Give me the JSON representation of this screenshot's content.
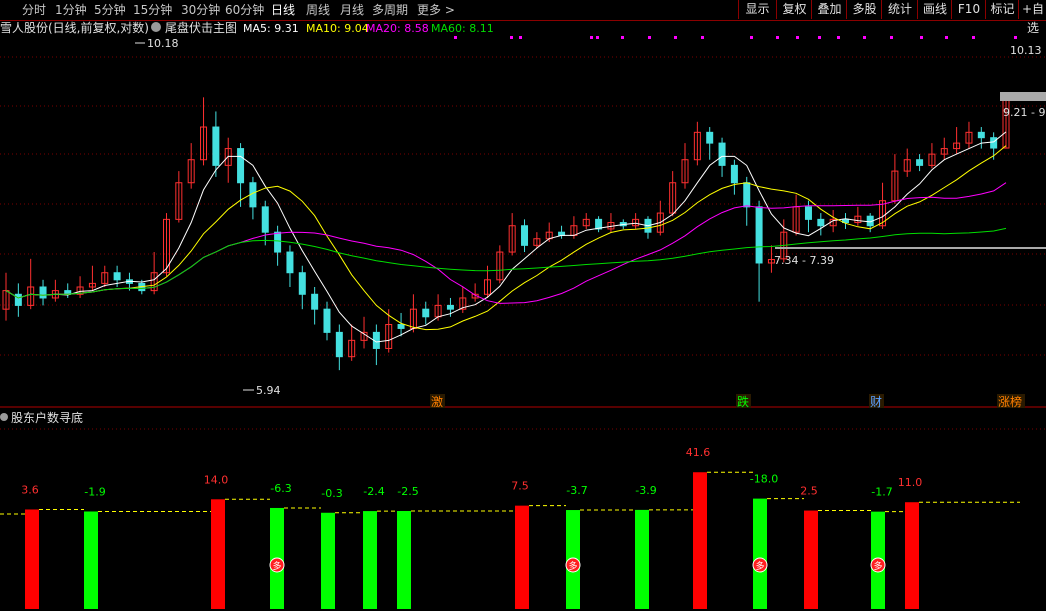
{
  "toolbar": {
    "periods": [
      "分时",
      "1分钟",
      "5分钟",
      "15分钟",
      "30分钟",
      "60分钟",
      "日线",
      "周线",
      "月线",
      "多周期",
      "更多 >"
    ],
    "active_index": 6,
    "right_buttons": [
      "显示",
      "复权",
      "叠加",
      "多股",
      "统计",
      "画线",
      "F10",
      "标记",
      "+自选"
    ]
  },
  "main_panel": {
    "title": "雪人股份(日线,前复权,对数)",
    "indicator_name": "尾盘伏击主图",
    "ma": [
      {
        "label": "MA5: 9.31",
        "color": "#ffffff"
      },
      {
        "label": "MA10: 9.04",
        "color": "#ffff00"
      },
      {
        "label": "MA20: 8.58",
        "color": "#ff00ff"
      },
      {
        "label": "MA60: 8.11",
        "color": "#00dd00"
      }
    ],
    "annotations": {
      "high": "10.18",
      "low": "5.94",
      "range": "7.34 - 7.39",
      "last_high": "10.13",
      "last_price": "9.21 - 9"
    },
    "events": [
      {
        "text": "激",
        "color": "#ff7f00"
      },
      {
        "text": "跌",
        "color": "#00ff00"
      },
      {
        "text": "财",
        "color": "#5aa0ff"
      },
      {
        "text": "涨榜",
        "color": "#ff7f00"
      }
    ]
  },
  "sub_panel": {
    "title": "股东户数寻底",
    "badge": "多"
  },
  "colors": {
    "up": "#ff3030",
    "down": "#44e0e0",
    "ma5": "#ffffff",
    "ma10": "#ffff00",
    "ma20": "#ff00ff",
    "ma60": "#00dd00",
    "bar_up": "#ff0000",
    "bar_down": "#00ff00"
  },
  "chart_data": {
    "type": "candlestick",
    "price_range": [
      5.6,
      11.4
    ],
    "scale": "log",
    "candles": [
      [
        6.7,
        6.95,
        7.2,
        6.55
      ],
      [
        6.9,
        6.75,
        7.05,
        6.6
      ],
      [
        6.75,
        7.0,
        7.4,
        6.7
      ],
      [
        7.0,
        6.85,
        7.1,
        6.75
      ],
      [
        6.85,
        6.95,
        7.1,
        6.8
      ],
      [
        6.95,
        6.9,
        7.05,
        6.85
      ],
      [
        6.9,
        7.0,
        7.15,
        6.85
      ],
      [
        7.0,
        7.05,
        7.3,
        6.95
      ],
      [
        7.05,
        7.2,
        7.3,
        7.0
      ],
      [
        7.2,
        7.1,
        7.3,
        7.0
      ],
      [
        7.1,
        7.05,
        7.2,
        6.95
      ],
      [
        7.05,
        6.95,
        7.1,
        6.9
      ],
      [
        6.95,
        7.2,
        7.5,
        6.9
      ],
      [
        7.2,
        8.0,
        8.1,
        7.15
      ],
      [
        8.0,
        8.6,
        8.8,
        7.95
      ],
      [
        8.6,
        9.0,
        9.3,
        8.5
      ],
      [
        9.0,
        9.6,
        10.18,
        8.9
      ],
      [
        9.6,
        8.9,
        9.9,
        8.7
      ],
      [
        8.9,
        9.2,
        9.4,
        8.6
      ],
      [
        9.2,
        8.6,
        9.3,
        8.2
      ],
      [
        8.6,
        8.2,
        8.7,
        8.0
      ],
      [
        8.2,
        7.8,
        8.3,
        7.6
      ],
      [
        7.8,
        7.5,
        7.9,
        7.3
      ],
      [
        7.5,
        7.2,
        7.6,
        7.0
      ],
      [
        7.2,
        6.9,
        7.3,
        6.7
      ],
      [
        6.9,
        6.7,
        7.0,
        6.5
      ],
      [
        6.7,
        6.4,
        6.8,
        6.3
      ],
      [
        6.4,
        6.1,
        6.5,
        5.94
      ],
      [
        6.1,
        6.3,
        6.5,
        6.05
      ],
      [
        6.3,
        6.4,
        6.6,
        6.2
      ],
      [
        6.4,
        6.2,
        6.5,
        6.0
      ],
      [
        6.2,
        6.5,
        6.7,
        6.15
      ],
      [
        6.5,
        6.45,
        6.65,
        6.35
      ],
      [
        6.45,
        6.7,
        6.9,
        6.4
      ],
      [
        6.7,
        6.6,
        6.8,
        6.5
      ],
      [
        6.6,
        6.75,
        6.9,
        6.55
      ],
      [
        6.75,
        6.7,
        6.85,
        6.6
      ],
      [
        6.7,
        6.85,
        7.0,
        6.65
      ],
      [
        6.85,
        6.9,
        7.05,
        6.8
      ],
      [
        6.9,
        7.1,
        7.3,
        6.85
      ],
      [
        7.1,
        7.5,
        7.6,
        7.05
      ],
      [
        7.5,
        7.9,
        8.1,
        7.45
      ],
      [
        7.9,
        7.6,
        8.0,
        7.5
      ],
      [
        7.6,
        7.7,
        7.8,
        7.55
      ],
      [
        7.7,
        7.8,
        7.95,
        7.65
      ],
      [
        7.8,
        7.75,
        7.9,
        7.7
      ],
      [
        7.75,
        7.9,
        8.05,
        7.7
      ],
      [
        7.9,
        8.0,
        8.1,
        7.85
      ],
      [
        8.0,
        7.85,
        8.05,
        7.8
      ],
      [
        7.85,
        7.95,
        8.1,
        7.8
      ],
      [
        7.95,
        7.9,
        8.0,
        7.85
      ],
      [
        7.9,
        8.0,
        8.1,
        7.85
      ],
      [
        8.0,
        7.8,
        8.05,
        7.7
      ],
      [
        7.8,
        8.1,
        8.3,
        7.75
      ],
      [
        8.1,
        8.6,
        8.8,
        8.05
      ],
      [
        8.6,
        9.0,
        9.3,
        8.5
      ],
      [
        9.0,
        9.5,
        9.7,
        8.9
      ],
      [
        9.5,
        9.3,
        9.6,
        9.0
      ],
      [
        9.3,
        8.9,
        9.4,
        8.7
      ],
      [
        8.9,
        8.6,
        9.0,
        8.4
      ],
      [
        8.6,
        8.2,
        8.7,
        7.9
      ],
      [
        8.2,
        7.34,
        8.3,
        6.8
      ],
      [
        7.34,
        7.39,
        7.6,
        7.2
      ],
      [
        7.4,
        7.8,
        8.0,
        7.35
      ],
      [
        7.8,
        8.2,
        8.4,
        7.75
      ],
      [
        8.2,
        8.0,
        8.3,
        7.8
      ],
      [
        8.0,
        7.9,
        8.1,
        7.75
      ],
      [
        7.9,
        8.0,
        8.15,
        7.8
      ],
      [
        8.0,
        7.95,
        8.1,
        7.85
      ],
      [
        7.95,
        8.05,
        8.2,
        7.9
      ],
      [
        8.05,
        7.9,
        8.1,
        7.8
      ],
      [
        7.9,
        8.3,
        8.6,
        7.85
      ],
      [
        8.3,
        8.8,
        9.1,
        8.25
      ],
      [
        8.8,
        9.0,
        9.2,
        8.7
      ],
      [
        9.0,
        8.9,
        9.1,
        8.8
      ],
      [
        8.9,
        9.1,
        9.3,
        8.85
      ],
      [
        9.1,
        9.2,
        9.4,
        9.0
      ],
      [
        9.2,
        9.3,
        9.6,
        9.1
      ],
      [
        9.3,
        9.5,
        9.7,
        9.2
      ],
      [
        9.5,
        9.4,
        9.6,
        9.2
      ],
      [
        9.4,
        9.21,
        9.5,
        9.0
      ],
      [
        9.21,
        10.13,
        10.2,
        9.2
      ]
    ],
    "histogram": [
      {
        "value": "3.6",
        "dir": "up"
      },
      {
        "value": "-1.9",
        "dir": "down"
      },
      {
        "value": "14.0",
        "dir": "up"
      },
      {
        "value": "-6.3",
        "dir": "down",
        "badge": true
      },
      {
        "value": "-0.3",
        "dir": "down"
      },
      {
        "value": "-2.4",
        "dir": "down"
      },
      {
        "value": "-2.5",
        "dir": "down"
      },
      {
        "value": "7.5",
        "dir": "up"
      },
      {
        "value": "-3.7",
        "dir": "down",
        "badge": true
      },
      {
        "value": "-3.9",
        "dir": "down"
      },
      {
        "value": "41.6",
        "dir": "up"
      },
      {
        "value": "-18.0",
        "dir": "down",
        "badge": true
      },
      {
        "value": "2.5",
        "dir": "up"
      },
      {
        "value": "-1.7",
        "dir": "down",
        "badge": true
      },
      {
        "value": "11.0",
        "dir": "up"
      }
    ]
  }
}
